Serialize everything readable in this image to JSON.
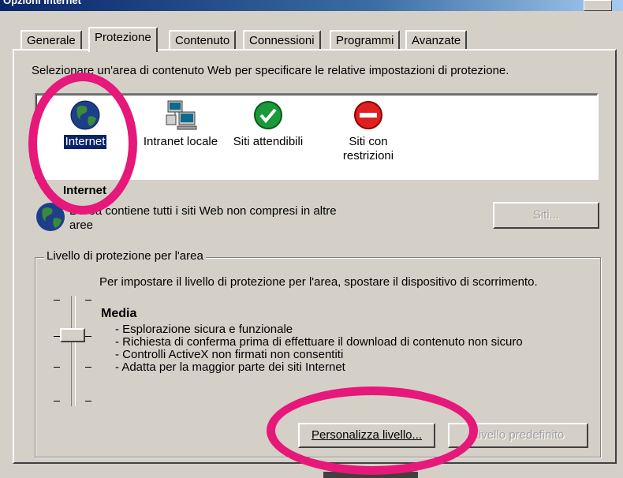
{
  "window": {
    "title": "Opzioni Internet"
  },
  "tabs": [
    {
      "label": "Generale"
    },
    {
      "label": "Protezione"
    },
    {
      "label": "Contenuto"
    },
    {
      "label": "Connessioni"
    },
    {
      "label": "Programmi"
    },
    {
      "label": "Avanzate"
    }
  ],
  "active_tab": "Protezione",
  "instruction": "Selezionare un'area di contenuto Web per specificare le relative impostazioni di protezione.",
  "zones": [
    {
      "label": "Internet",
      "icon": "globe-icon",
      "selected": true
    },
    {
      "label": "Intranet locale",
      "icon": "network-computers-icon",
      "selected": false
    },
    {
      "label": "Siti attendibili",
      "icon": "green-check-icon",
      "selected": false
    },
    {
      "label": "Siti con restrizioni",
      "line1": "Siti con",
      "line2": "restrizioni",
      "icon": "red-no-entry-icon",
      "selected": false
    }
  ],
  "zone_info": {
    "title": "Internet",
    "description_line1": "L'area contiene tutti i siti Web non compresi in altre",
    "description_line2": "aree",
    "sites_button": "Siti..."
  },
  "security_level": {
    "group_label": "Livello di protezione per l'area",
    "hint": "Per impostare il livello di protezione per l'area, spostare il dispositivo di scorrimento.",
    "level_name": "Media",
    "level_index": 2,
    "level_count": 4,
    "features": [
      "- Esplorazione sicura e funzionale",
      "- Richiesta di conferma prima di effettuare il download di contenuto non sicuro",
      "- Controlli ActiveX non firmati non consentiti",
      "- Adatta per la maggior parte dei siti Internet"
    ],
    "custom_button": "Personalizza livello...",
    "default_button": "Livello predefinito"
  },
  "colors": {
    "dialog_bg": "#d4d0c8",
    "selection": "#0a246a",
    "annotation_ring": "#e6187a"
  }
}
